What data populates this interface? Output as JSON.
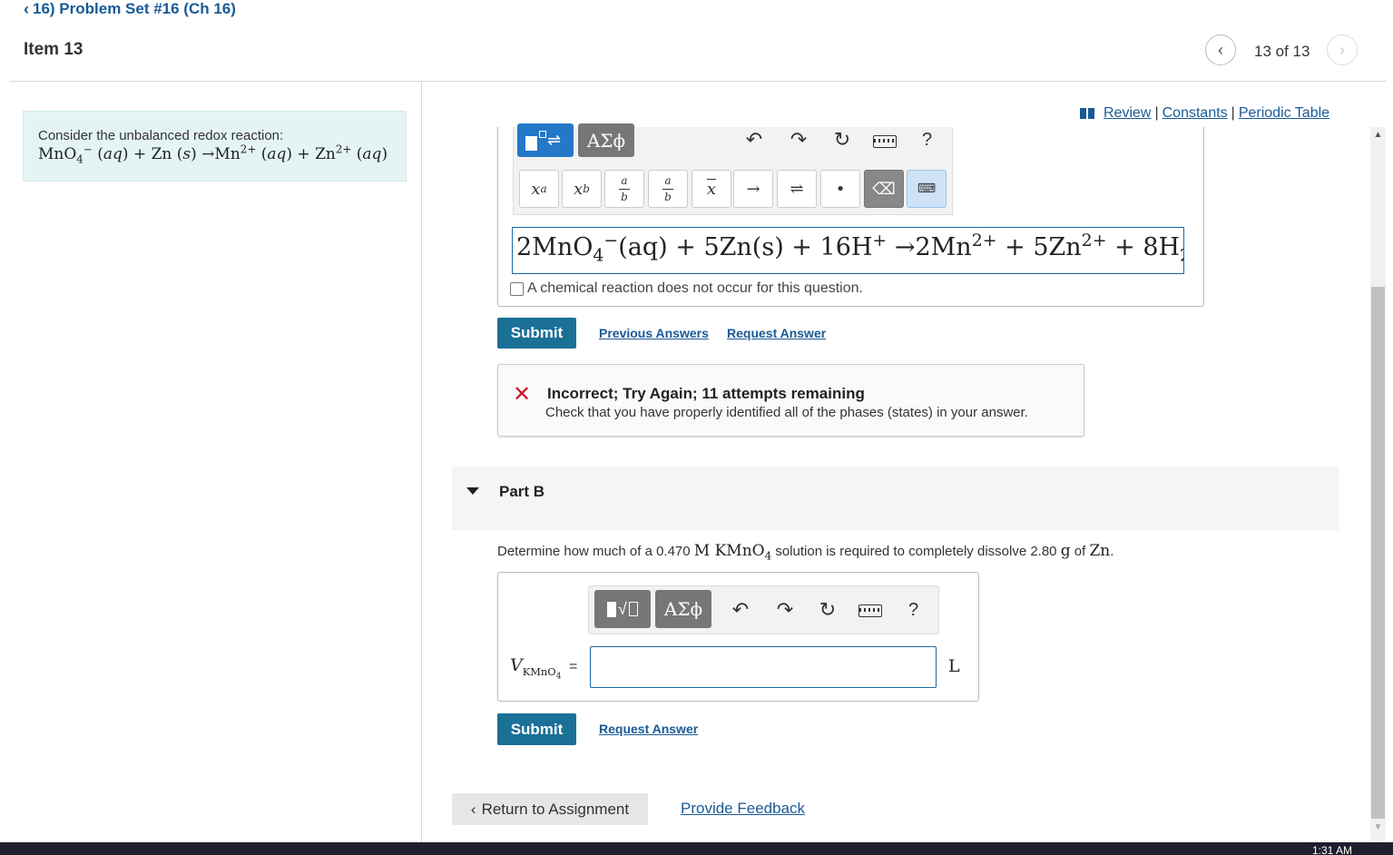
{
  "header": {
    "back_label": "16) Problem Set #16 (Ch 16)",
    "item_title": "Item 13",
    "counter": "13 of 13"
  },
  "left_panel": {
    "intro": "Consider the unbalanced redox reaction:"
  },
  "top_links": {
    "review": "Review",
    "constants": "Constants",
    "periodic_table": "Periodic Table",
    "separator": "|"
  },
  "part_a": {
    "greek_label": "ΑΣϕ",
    "help_label": "?",
    "no_reaction_label": "A chemical reaction does not occur for this question.",
    "submit_label": "Submit",
    "previous_answers_label": "Previous Answers",
    "request_answer_label": "Request Answer",
    "feedback_title": "Incorrect; Try Again; 11 attempts remaining",
    "feedback_message": "Check that you have properly identified all of the phases (states) in your answer."
  },
  "part_b": {
    "title": "Part B",
    "question_prefix": "Determine how much of a 0.470",
    "question_mid": "solution is required to completely dissolve 2.80",
    "question_of": "of",
    "greek_label": "ΑΣϕ",
    "help_label": "?",
    "input_value": "",
    "unit": "L",
    "submit_label": "Submit",
    "request_answer_label": "Request Answer"
  },
  "footer": {
    "return_label": "Return to Assignment",
    "feedback_label": "Provide Feedback"
  },
  "taskbar": {
    "time": "1:31 AM"
  },
  "colors": {
    "link": "#1a5a96",
    "submit": "#1a7096",
    "error": "#d0182c",
    "panel_bg": "#e4f4f4"
  }
}
